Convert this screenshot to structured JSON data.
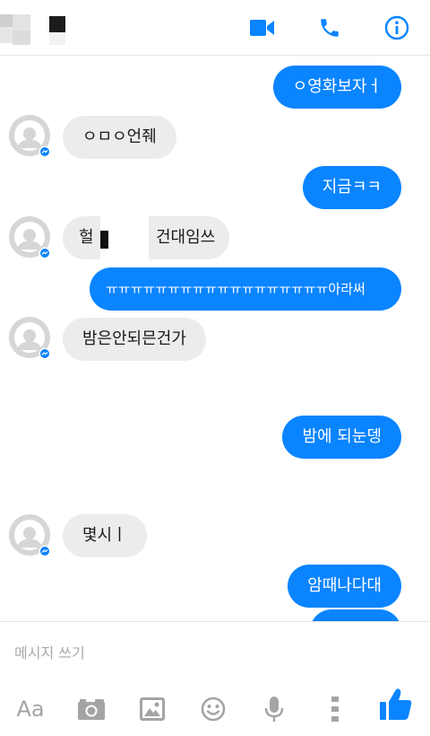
{
  "conversation": {
    "messages": [
      {
        "side": "out",
        "text": "ㅇ영화보자ㅓ"
      },
      {
        "side": "in",
        "text": "ㅇㅁㅇ언줴"
      },
      {
        "side": "out",
        "text": "지금ㅋㅋ"
      },
      {
        "side": "in",
        "text_before": "헐",
        "text_after": "건대임쓰"
      },
      {
        "side": "out",
        "text": "ㅠㅠㅠㅠㅠㅠㅠㅠㅠㅠㅠㅠㅠㅠㅠㅠㅠㅠ아라써"
      },
      {
        "side": "in",
        "text": "밤은안되믄건가"
      },
      {
        "side": "out",
        "text": "밤에 되눈뎅"
      },
      {
        "side": "in",
        "text": "몇시ㅣ"
      },
      {
        "side": "out",
        "text": "암때나다대"
      }
    ]
  },
  "composer": {
    "placeholder": "메시지 쓰기",
    "font_button_label": "Aa"
  },
  "icons": {
    "header": [
      "video-call-icon",
      "phone-call-icon",
      "info-icon"
    ],
    "toolbar": [
      "camera-icon",
      "gallery-icon",
      "emoji-icon",
      "microphone-icon",
      "more-icon",
      "like-icon"
    ]
  },
  "colors": {
    "accent": "#0a84ff",
    "incoming_bubble": "#ececec",
    "toolbar_icon": "#a4a4a4"
  }
}
